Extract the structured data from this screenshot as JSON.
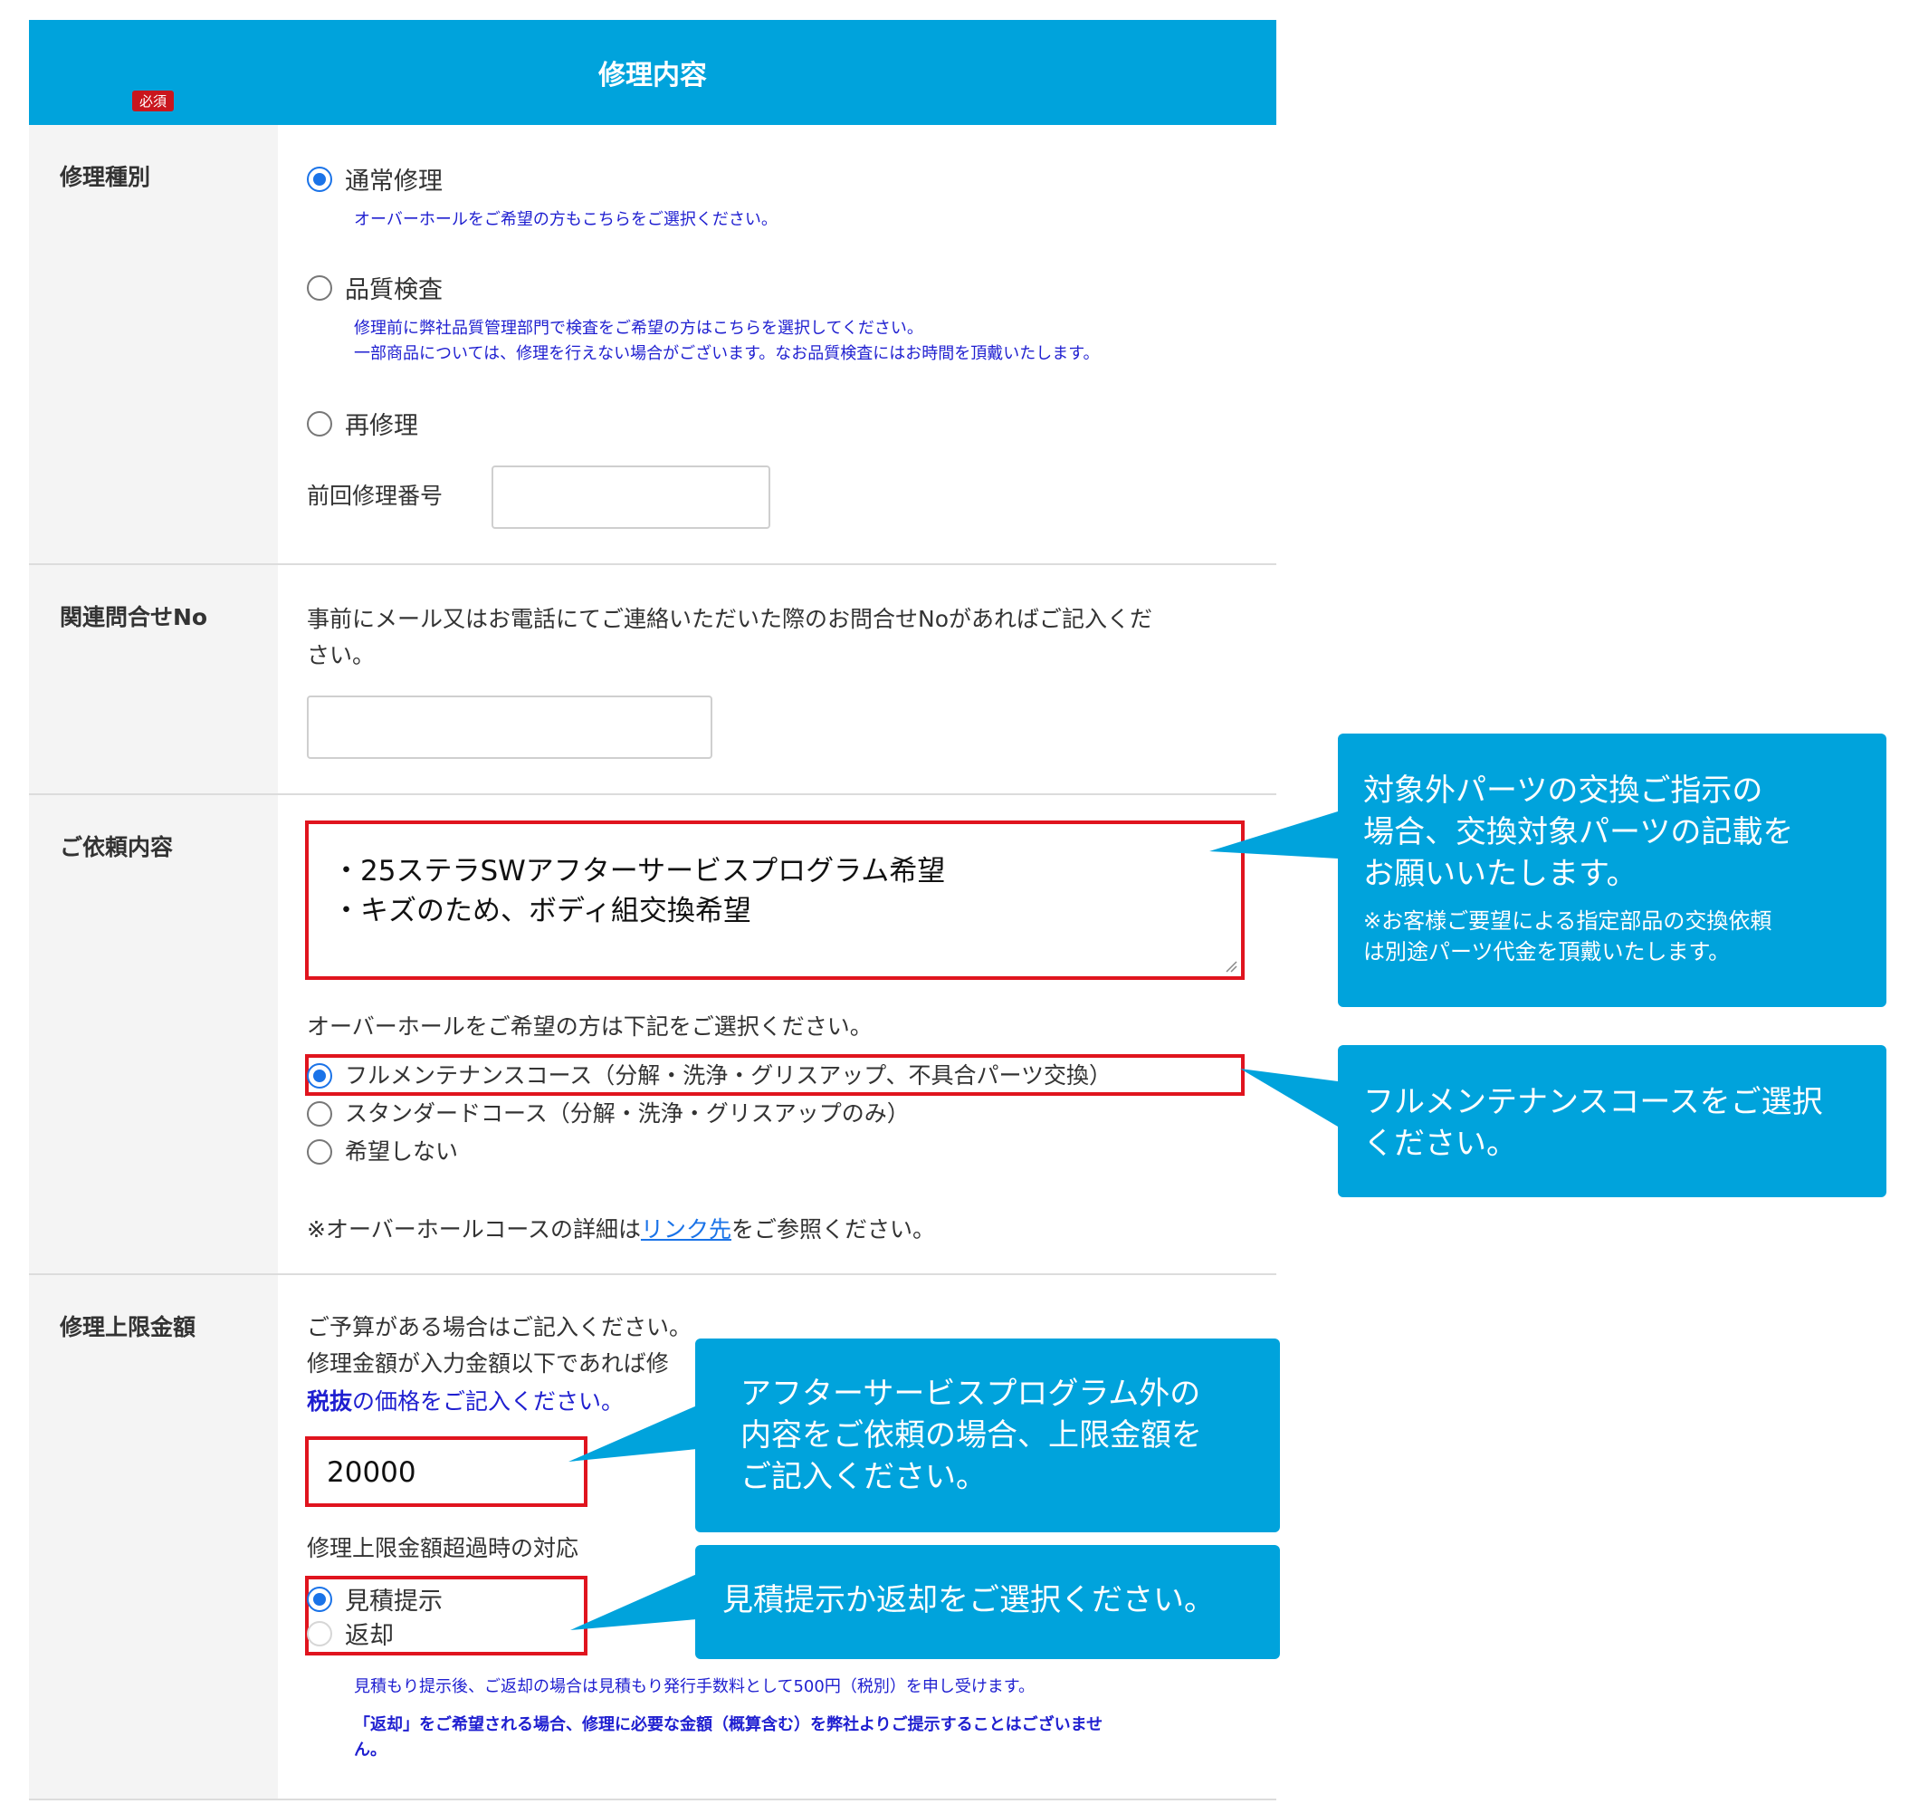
{
  "header": {
    "title": "修理内容"
  },
  "repair_type": {
    "label": "修理種別",
    "options": [
      {
        "label": "通常修理",
        "checked": true,
        "notes": [
          "オーバーホールをご希望の方もこちらをご選択ください。"
        ]
      },
      {
        "label": "品質検査",
        "checked": false,
        "notes": [
          "修理前に弊社品質管理部門で検査をご希望の方はこちらを選択してください。",
          "一部商品については、修理を行えない場合がございます。なお品質検査にはお時間を頂戴いたします。"
        ]
      },
      {
        "label": "再修理",
        "checked": false,
        "notes": []
      }
    ],
    "prev_number_label": "前回修理番号",
    "prev_number_value": ""
  },
  "inquiry": {
    "label": "関連問合せNo",
    "description_line1": "事前にメール又はお電話にてご連絡いただいた際のお問合せNoがあればご記入くだ",
    "description_line2": "さい。",
    "value": ""
  },
  "request": {
    "label": "ご依頼内容",
    "required_badge": "必須",
    "textarea_lines": [
      "・25ステラSWアフターサービスプログラム希望",
      "・キズのため、ボディ組交換希望"
    ],
    "overhaul_prompt": "オーバーホールをご希望の方は下記をご選択ください。",
    "overhaul_options": [
      {
        "label": "フルメンテナンスコース（分解・洗浄・グリスアップ、不具合パーツ交換）",
        "checked": true
      },
      {
        "label": "スタンダードコース（分解・洗浄・グリスアップのみ）",
        "checked": false
      },
      {
        "label": "希望しない",
        "checked": false
      }
    ],
    "detail_prefix": "※オーバーホールコースの詳細は",
    "detail_link": "リンク先",
    "detail_suffix": "をご参照ください。"
  },
  "limit": {
    "label": "修理上限金額",
    "line1": "ご予算がある場合はご記入ください。",
    "line2": "修理金額が入力金額以下であれば修",
    "tax_bold": "税抜",
    "tax_rest": "の価格をご記入ください。",
    "amount_value": "20000",
    "exceed_label": "修理上限金額超過時の対応",
    "exceed_options": [
      {
        "label": "見積提示",
        "checked": true
      },
      {
        "label": "返却",
        "checked": false
      }
    ],
    "note1": "見積もり提示後、ご返却の場合は見積もり発行手数料として500円（税別）を申し受けます。",
    "note2_line1": "「返却」をご希望される場合、修理に必要な金額（概算含む）を弊社よりご提示することはございませ",
    "note2_line2": "ん。"
  },
  "callouts": {
    "parts": {
      "text": "対象外パーツの交換ご指示の\n場合、交換対象パーツの記載を\nお願いいたします。",
      "subtext": "※お客様ご要望による指定部品の交換依頼\nは別途パーツ代金を頂戴いたします。"
    },
    "course": {
      "text": "フルメンテナンスコースをご選択\nください。"
    },
    "amount": {
      "text": "アフターサービスプログラム外の\n内容をご依頼の場合、上限金額を\nご記入ください。"
    },
    "exceed": {
      "text": "見積提示か返却をご選択ください。"
    }
  },
  "colors": {
    "accent": "#00a3dc",
    "highlight": "#e0141e",
    "note_text": "#1f1fd0",
    "radio_checked": "#1a73e8"
  }
}
